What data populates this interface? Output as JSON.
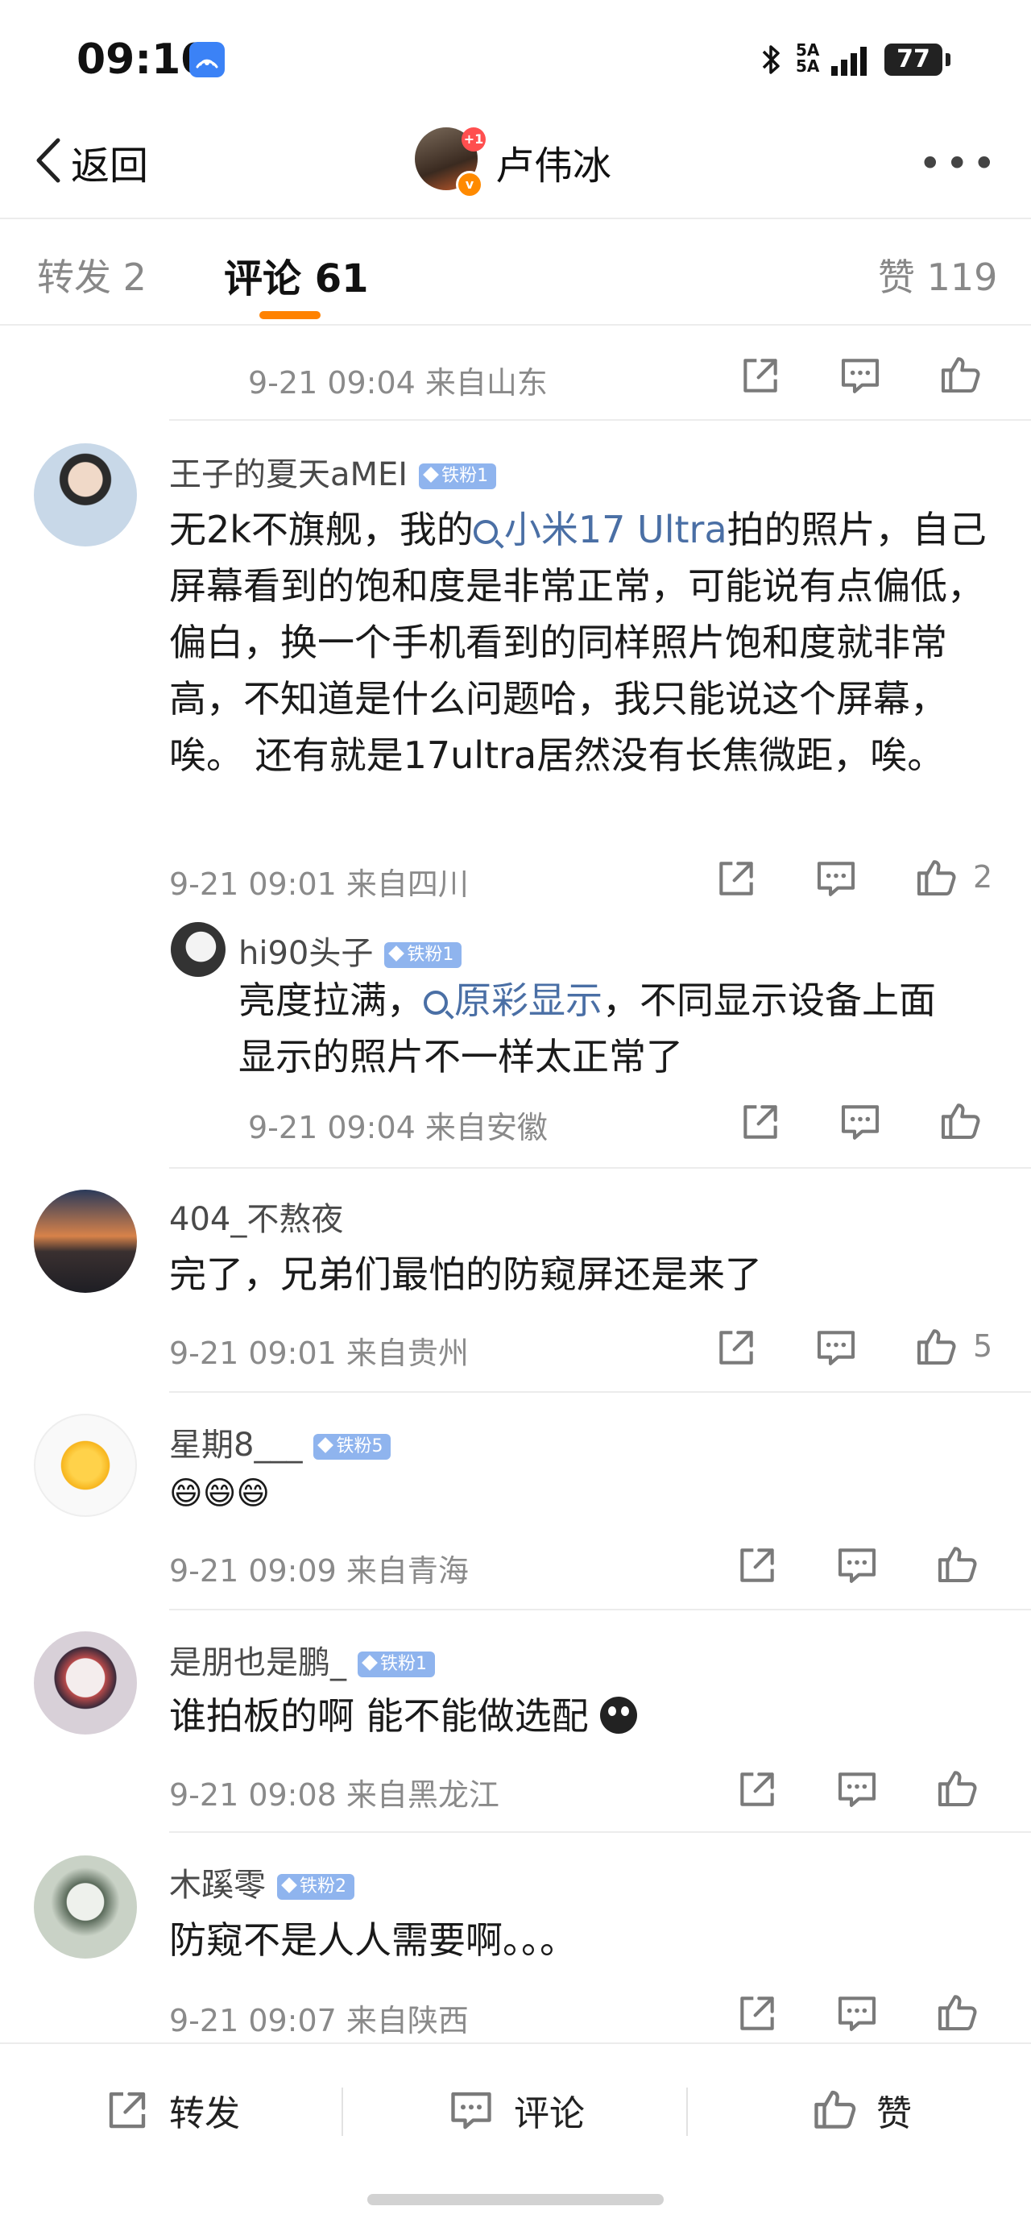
{
  "status_bar": {
    "time": "09:10",
    "network": "5A\n5A",
    "battery": "77"
  },
  "nav": {
    "back_label": "返回",
    "title": "卢伟冰",
    "avatar_badge": "+1",
    "verified_mark": "v",
    "more": "•••"
  },
  "tabs": {
    "forward": "转发 2",
    "comment": "评论 61",
    "like": "赞 119"
  },
  "top_meta": "9-21 09:04 来自山东",
  "comments": [
    {
      "user": "王子的夏天aMEI",
      "fan_badge": "铁粉1",
      "text_a": "无2k不旗舰，我的",
      "topic": "小米17 Ultra",
      "text_b": "拍的照片，自己屏幕看到的饱和度是非常正常，可能说有点偏低，偏白，换一个手机看到的同样照片饱和度就非常高，不知道是什么问题哈，我只能说这个屏幕，唉。 还有就是17ultra居然没有长焦微距，唉。",
      "meta": "9-21 09:01 来自四川",
      "likes": "2",
      "reply": {
        "user": "hi90头子",
        "fan_badge": "铁粉1",
        "text_a": "亮度拉满，",
        "topic": "原彩显示",
        "text_b": "，不同显示设备上面显示的照片不一样太正常了",
        "meta": "9-21 09:04 来自安徽"
      }
    },
    {
      "user": "404_不熬夜",
      "text": "完了，兄弟们最怕的防窥屏还是来了",
      "meta": "9-21 09:01 来自贵州",
      "likes": "5"
    },
    {
      "user": "星期8___",
      "fan_badge": "铁粉5",
      "text": "😄😄😄",
      "meta": "9-21 09:09 来自青海"
    },
    {
      "user": "是朋也是鹏_",
      "fan_badge": "铁粉1",
      "text": "谁拍板的啊 能不能做选配",
      "meta": "9-21 09:08 来自黑龙江"
    },
    {
      "user": "木蹊零",
      "fan_badge": "铁粉2",
      "text": "防窥不是人人需要啊。。。",
      "meta": "9-21 09:07 来自陕西"
    }
  ],
  "bottom_bar": {
    "forward": "转发",
    "comment": "评论",
    "like": "赞"
  },
  "colors": {
    "accent": "#ff8200",
    "topic": "#4a6fa5",
    "fan_badge": "#8fb4ee"
  }
}
